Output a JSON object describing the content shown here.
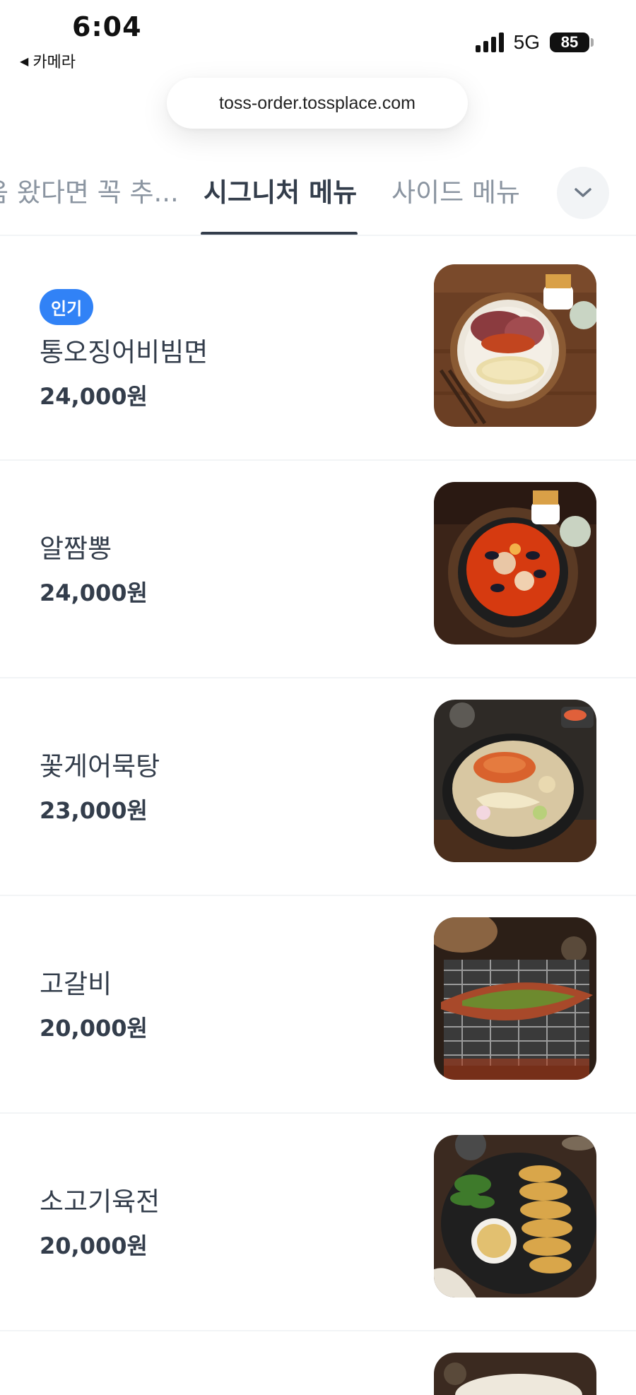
{
  "status_bar": {
    "time": "6:04",
    "back_label": "카메라",
    "network": "5G",
    "battery": "85"
  },
  "browser": {
    "url": "toss-order.tossplace.com"
  },
  "tabs": [
    {
      "label": "음 왔다면 꼭 추..."
    },
    {
      "label": "시그니처 메뉴",
      "active": true
    },
    {
      "label": "사이드 메뉴"
    }
  ],
  "menu": [
    {
      "badge": "인기",
      "name": "통오징어비빔면",
      "price": "24,000원",
      "photo": "squid-noodle-photo"
    },
    {
      "name": "알짬뽕",
      "price": "24,000원",
      "photo": "seafood-stew-photo"
    },
    {
      "name": "꽃게어묵탕",
      "price": "23,000원",
      "photo": "crab-fishcake-soup-photo"
    },
    {
      "name": "고갈비",
      "price": "20,000원",
      "photo": "grilled-mackerel-photo"
    },
    {
      "name": "소고기육전",
      "price": "20,000원",
      "photo": "beef-jeon-photo"
    }
  ],
  "colors": {
    "accent": "#3182f6",
    "text_primary": "#333d4b",
    "text_secondary": "#8b95a1",
    "divider": "#f2f4f6"
  }
}
